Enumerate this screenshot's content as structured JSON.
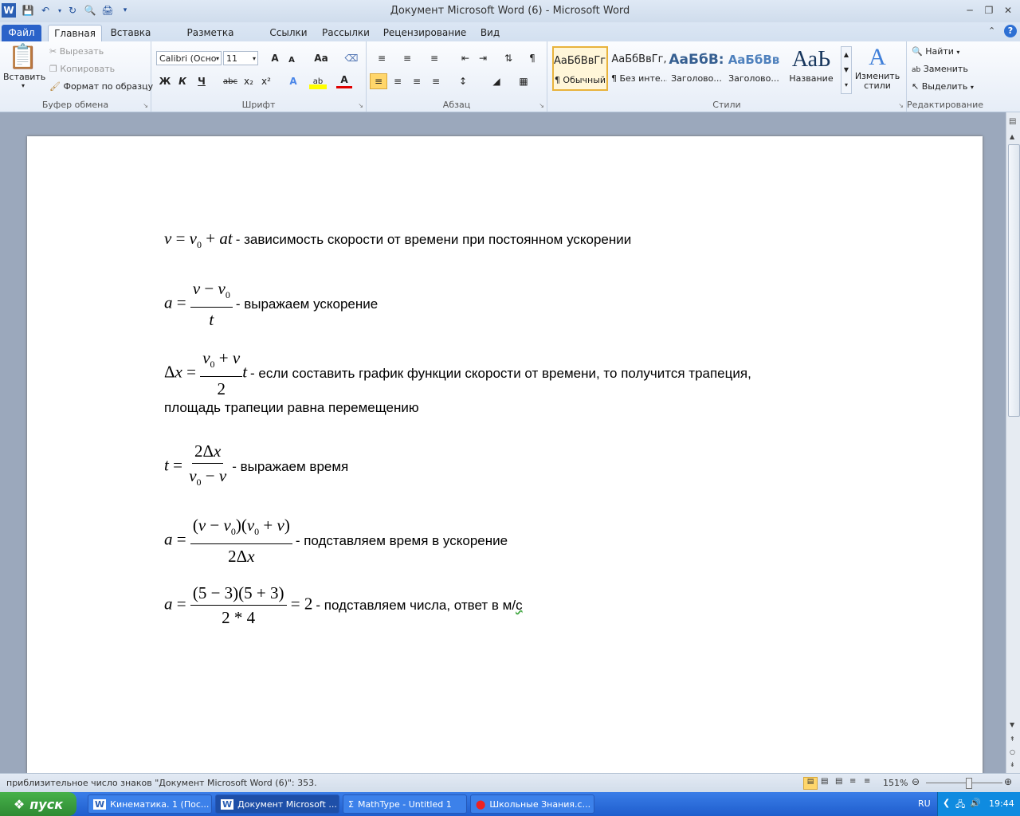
{
  "window": {
    "title": "Документ Microsoft Word (6)  -  Microsoft Word"
  },
  "tabs": [
    {
      "label": "Файл"
    },
    {
      "label": "Главная"
    },
    {
      "label": "Вставка"
    },
    {
      "label": "Разметка страницы"
    },
    {
      "label": "Ссылки"
    },
    {
      "label": "Рассылки"
    },
    {
      "label": "Рецензирование"
    },
    {
      "label": "Вид"
    }
  ],
  "clipboard": {
    "paste": "Вставить",
    "cut": "Вырезать",
    "copy": "Копировать",
    "format_painter": "Формат по образцу",
    "label": "Буфер обмена"
  },
  "font": {
    "name": "Calibri (Осно",
    "size": "11",
    "label": "Шрифт",
    "bold": "Ж",
    "italic": "К",
    "underline": "Ч",
    "strike": "abc",
    "sub": "x₂",
    "sup": "x²",
    "grow": "A",
    "shrink": "A",
    "case": "Aa",
    "font_color_letter": "A",
    "highlight_letter": "ab"
  },
  "paragraph": {
    "label": "Абзац"
  },
  "styles": {
    "label": "Стили",
    "items": [
      {
        "preview": "АаБбВвГг,",
        "name": "¶ Обычный"
      },
      {
        "preview": "АаБбВвГг,",
        "name": "¶ Без инте..."
      },
      {
        "preview": "АаБбВ:",
        "name": "Заголово..."
      },
      {
        "preview": "АаБбВв",
        "name": "Заголово..."
      },
      {
        "preview": "АаЬ",
        "name": "Название"
      }
    ],
    "change_styles": "Изменить стили"
  },
  "editing": {
    "label": "Редактирование",
    "find": "Найти",
    "replace": "Заменить",
    "select": "Выделить"
  },
  "document": {
    "t1": "- зависимость скорости от времени при постоянном ускорении",
    "t2": "- выражаем ускорение",
    "t3a": "- если составить график функции скорости от времени, то получится трапеция,",
    "t3b": "площадь трапеции равна перемещению",
    "t4": "- выражаем время",
    "t5": "- подставляем время в ускорение",
    "t6": "- подставляем числа, ответ в м/",
    "t6c": "с"
  },
  "statusbar": {
    "text": "приблизительное число знаков \"Документ Microsoft Word (6)\": 353.",
    "zoom": "151%"
  },
  "taskbar": {
    "start": "пуск",
    "tasks": [
      {
        "label": "Кинематика. 1 (Пос..."
      },
      {
        "label": "Документ Microsoft ..."
      },
      {
        "label": "MathType - Untitled 1"
      },
      {
        "label": "Школьные Знания.с..."
      }
    ],
    "lang": "RU",
    "time": "19:44"
  }
}
